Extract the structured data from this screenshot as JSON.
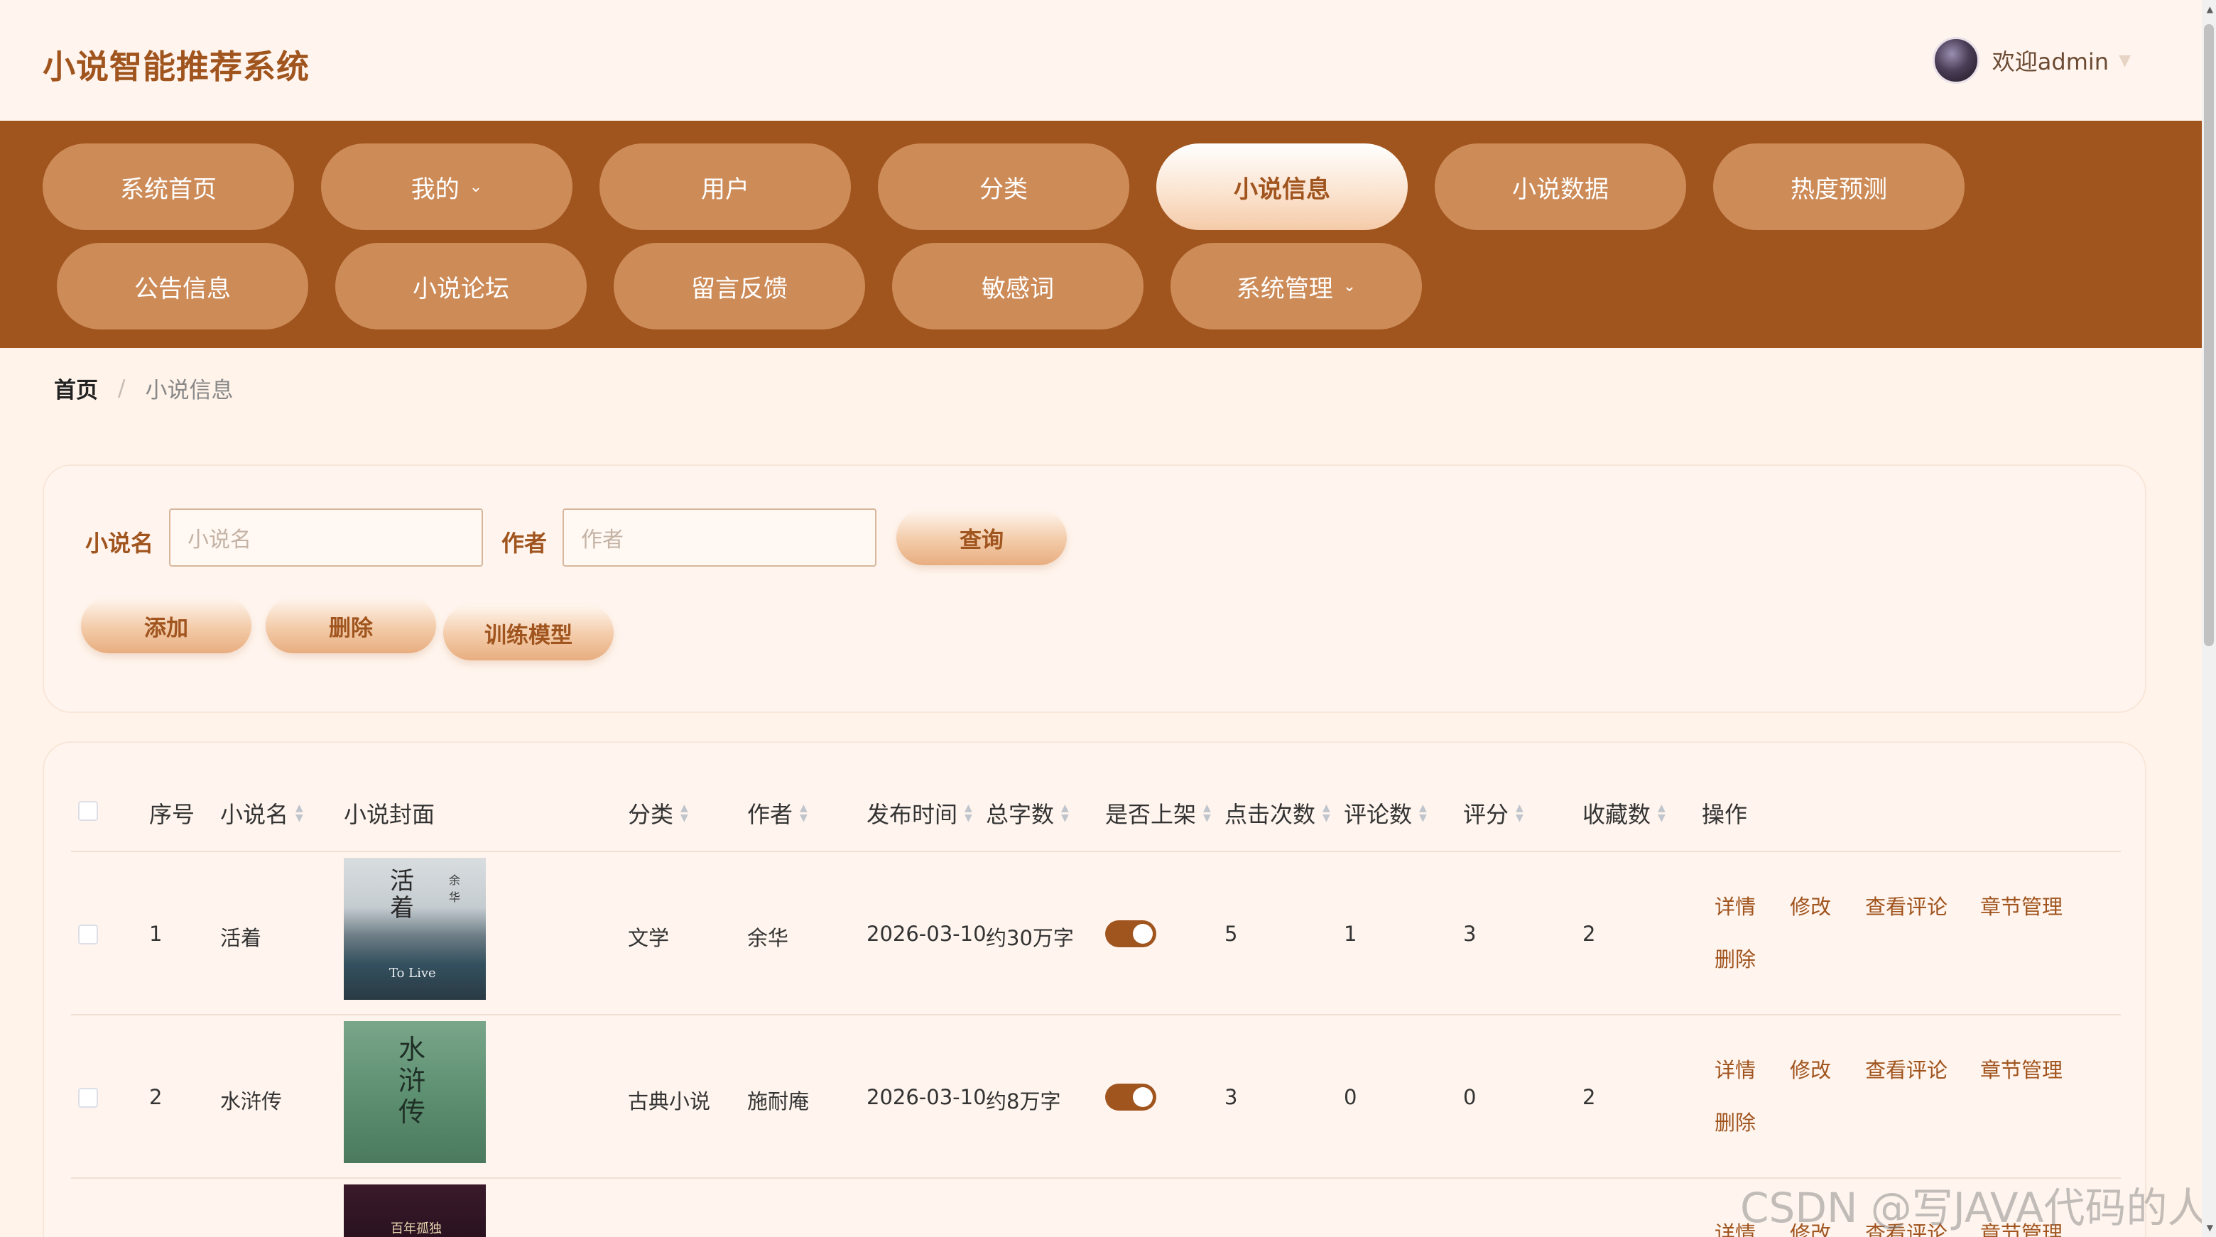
{
  "header": {
    "logo": "小说智能推荐系统",
    "welcome": "欢迎admin"
  },
  "nav": {
    "items": [
      {
        "label": "系统首页"
      },
      {
        "label": "我的",
        "has_caret": true
      },
      {
        "label": "用户"
      },
      {
        "label": "分类"
      },
      {
        "label": "小说信息",
        "active": true
      },
      {
        "label": "小说数据"
      },
      {
        "label": "热度预测"
      },
      {
        "label": "公告信息"
      },
      {
        "label": "小说论坛"
      },
      {
        "label": "留言反馈"
      },
      {
        "label": "敏感词"
      },
      {
        "label": "系统管理",
        "has_caret": true
      }
    ]
  },
  "breadcrumb": {
    "home": "首页",
    "separator": "/",
    "current": "小说信息"
  },
  "search": {
    "name_label": "小说名",
    "name_placeholder": "小说名",
    "author_label": "作者",
    "author_placeholder": "作者",
    "query_button": "查询",
    "add_button": "添加",
    "delete_button": "删除",
    "train_button": "训练模型"
  },
  "table": {
    "headers": {
      "index": "序号",
      "name": "小说名",
      "cover": "小说封面",
      "category": "分类",
      "author": "作者",
      "publish_time": "发布时间",
      "word_count": "总字数",
      "on_shelf": "是否上架",
      "clicks": "点击次数",
      "comments": "评论数",
      "rating": "评分",
      "favorites": "收藏数",
      "actions": "操作"
    },
    "actions": {
      "detail": "详情",
      "edit": "修改",
      "view_comments": "查看评论",
      "chapters": "章节管理",
      "delete": "删除"
    },
    "rows": [
      {
        "index": "1",
        "name": "活着",
        "category": "文学",
        "author": "余华",
        "publish_time": "2026-03-10",
        "word_count": "约30万字",
        "on_shelf": true,
        "clicks": "5",
        "comments": "1",
        "rating": "3",
        "favorites": "2",
        "cover_title": "活着",
        "cover_author": "余华",
        "cover_sub": "To Live"
      },
      {
        "index": "2",
        "name": "水浒传",
        "category": "古典小说",
        "author": "施耐庵",
        "publish_time": "2026-03-10",
        "word_count": "约8万字",
        "on_shelf": true,
        "clicks": "3",
        "comments": "0",
        "rating": "0",
        "favorites": "2",
        "cover_title": "水浒传"
      },
      {
        "cover_title": "百年孤独"
      }
    ]
  },
  "watermark": "CSDN @写JAVA代码的人",
  "colors": {
    "brand": "#a0541e",
    "nav_button": "#cd8b58",
    "page_bg": "#fff3ea"
  }
}
